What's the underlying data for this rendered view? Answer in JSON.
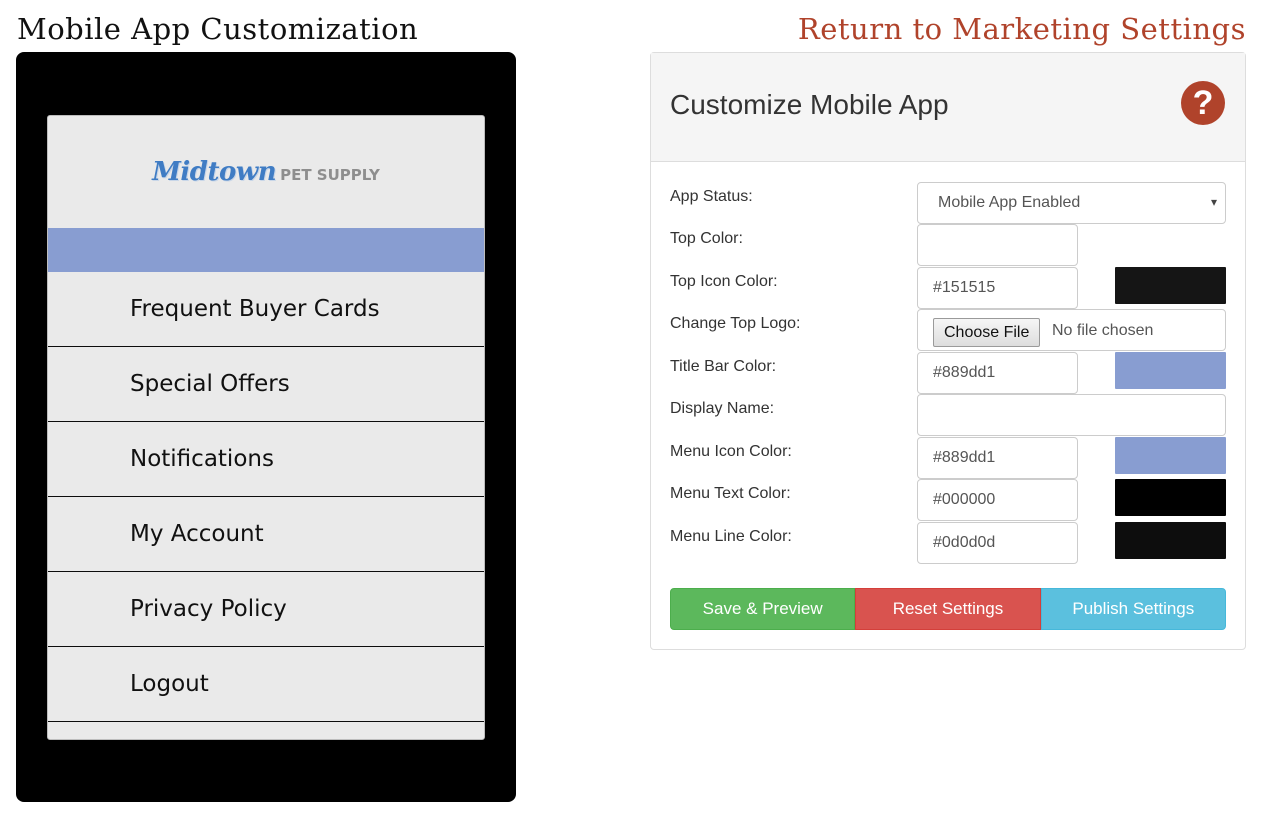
{
  "page": {
    "title": "Mobile App Customization",
    "return_link": "Return to Marketing Settings"
  },
  "preview": {
    "logo_script": "Midtown",
    "logo_sub": "PET SUPPLY",
    "title_bar_color": "#889dd1",
    "menu_line_color": "#0d0d0d",
    "menu_items": [
      "Frequent Buyer Cards",
      "Special Offers",
      "Notifications",
      "My Account",
      "Privacy Policy",
      "Logout"
    ]
  },
  "panel": {
    "title": "Customize Mobile App",
    "help_icon": "question-circle-icon",
    "help_glyph": "?",
    "accent": "#b0432b",
    "fields": {
      "app_status": {
        "label": "App Status:",
        "value": "Mobile App Enabled",
        "arrow": "▾"
      },
      "top_color": {
        "label": "Top Color:",
        "value": ""
      },
      "top_icon_color": {
        "label": "Top Icon Color:",
        "value": "#151515",
        "swatch": "#151515"
      },
      "top_logo": {
        "label": "Change Top Logo:",
        "button": "Choose File",
        "status": "No file chosen"
      },
      "title_bar_color": {
        "label": "Title Bar Color:",
        "value": "#889dd1",
        "swatch": "#889dd1"
      },
      "display_name": {
        "label": "Display Name:",
        "value": ""
      },
      "menu_icon_color": {
        "label": "Menu Icon Color:",
        "value": "#889dd1",
        "swatch": "#889dd1"
      },
      "menu_text_color": {
        "label": "Menu Text Color:",
        "value": "#000000",
        "swatch": "#000000"
      },
      "menu_line_color": {
        "label": "Menu Line Color:",
        "value": "#0d0d0d",
        "swatch": "#0d0d0d"
      }
    },
    "buttons": {
      "save": "Save & Preview",
      "reset": "Reset Settings",
      "publish": "Publish Settings"
    }
  }
}
